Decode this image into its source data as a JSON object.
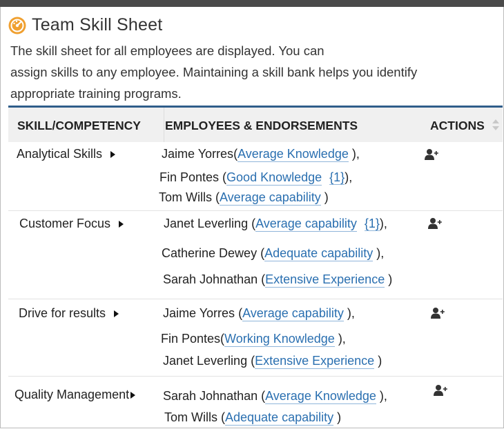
{
  "header": {
    "title": "Team Skill Sheet",
    "description_lines": [
      "The skill sheet for all employees are displayed. You can",
      "assign skills to any employee. Maintaining a skill bank helps you identify",
      "appropriate training programs."
    ],
    "icon": "dashboard-gauge-icon",
    "accent_color": "#f0a030"
  },
  "table": {
    "columns": [
      "SKILL/COMPETENCY",
      "EMPLOYEES & ENDORSEMENTS",
      "ACTIONS"
    ],
    "rows": [
      {
        "skill": "Analytical Skills",
        "employees": [
          {
            "name": "Jaime Yorres",
            "level": "Average Knowledge",
            "count": ""
          },
          {
            "name": "Fin Pontes",
            "level": "Good Knowledge",
            "count": "{1}"
          },
          {
            "name": "Tom Wills",
            "level": "Average capability",
            "count": ""
          }
        ]
      },
      {
        "skill": "Customer Focus",
        "employees": [
          {
            "name": "Janet Leverling",
            "level": "Average capability",
            "count": "{1}"
          },
          {
            "name": "Catherine Dewey",
            "level": "Adequate capability",
            "count": ""
          },
          {
            "name": "Sarah Johnathan",
            "level": "Extensive Experience",
            "count": ""
          }
        ]
      },
      {
        "skill": "Drive for results",
        "employees": [
          {
            "name": "Jaime Yorres",
            "level": "Average capability",
            "count": ""
          },
          {
            "name": "Fin Pontes",
            "level": "Working Knowledge",
            "count": ""
          },
          {
            "name": "Janet Leverling",
            "level": "Extensive Experience",
            "count": ""
          }
        ]
      },
      {
        "skill": "Quality Management",
        "employees": [
          {
            "name": "Sarah Johnathan",
            "level": "Average Knowledge",
            "count": ""
          },
          {
            "name": "Tom Wills",
            "level": "Adequate capability",
            "count": ""
          }
        ]
      }
    ],
    "action_icon": "add-user-icon",
    "link_color": "#2a6fb0"
  }
}
